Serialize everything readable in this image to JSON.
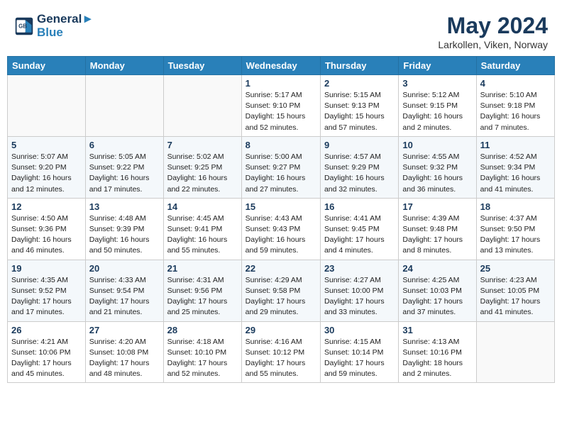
{
  "header": {
    "logo_line1": "General",
    "logo_line2": "Blue",
    "month": "May 2024",
    "location": "Larkollen, Viken, Norway"
  },
  "weekdays": [
    "Sunday",
    "Monday",
    "Tuesday",
    "Wednesday",
    "Thursday",
    "Friday",
    "Saturday"
  ],
  "weeks": [
    [
      {
        "day": "",
        "sunrise": "",
        "sunset": "",
        "daylight": ""
      },
      {
        "day": "",
        "sunrise": "",
        "sunset": "",
        "daylight": ""
      },
      {
        "day": "",
        "sunrise": "",
        "sunset": "",
        "daylight": ""
      },
      {
        "day": "1",
        "sunrise": "Sunrise: 5:17 AM",
        "sunset": "Sunset: 9:10 PM",
        "daylight": "Daylight: 15 hours and 52 minutes."
      },
      {
        "day": "2",
        "sunrise": "Sunrise: 5:15 AM",
        "sunset": "Sunset: 9:13 PM",
        "daylight": "Daylight: 15 hours and 57 minutes."
      },
      {
        "day": "3",
        "sunrise": "Sunrise: 5:12 AM",
        "sunset": "Sunset: 9:15 PM",
        "daylight": "Daylight: 16 hours and 2 minutes."
      },
      {
        "day": "4",
        "sunrise": "Sunrise: 5:10 AM",
        "sunset": "Sunset: 9:18 PM",
        "daylight": "Daylight: 16 hours and 7 minutes."
      }
    ],
    [
      {
        "day": "5",
        "sunrise": "Sunrise: 5:07 AM",
        "sunset": "Sunset: 9:20 PM",
        "daylight": "Daylight: 16 hours and 12 minutes."
      },
      {
        "day": "6",
        "sunrise": "Sunrise: 5:05 AM",
        "sunset": "Sunset: 9:22 PM",
        "daylight": "Daylight: 16 hours and 17 minutes."
      },
      {
        "day": "7",
        "sunrise": "Sunrise: 5:02 AM",
        "sunset": "Sunset: 9:25 PM",
        "daylight": "Daylight: 16 hours and 22 minutes."
      },
      {
        "day": "8",
        "sunrise": "Sunrise: 5:00 AM",
        "sunset": "Sunset: 9:27 PM",
        "daylight": "Daylight: 16 hours and 27 minutes."
      },
      {
        "day": "9",
        "sunrise": "Sunrise: 4:57 AM",
        "sunset": "Sunset: 9:29 PM",
        "daylight": "Daylight: 16 hours and 32 minutes."
      },
      {
        "day": "10",
        "sunrise": "Sunrise: 4:55 AM",
        "sunset": "Sunset: 9:32 PM",
        "daylight": "Daylight: 16 hours and 36 minutes."
      },
      {
        "day": "11",
        "sunrise": "Sunrise: 4:52 AM",
        "sunset": "Sunset: 9:34 PM",
        "daylight": "Daylight: 16 hours and 41 minutes."
      }
    ],
    [
      {
        "day": "12",
        "sunrise": "Sunrise: 4:50 AM",
        "sunset": "Sunset: 9:36 PM",
        "daylight": "Daylight: 16 hours and 46 minutes."
      },
      {
        "day": "13",
        "sunrise": "Sunrise: 4:48 AM",
        "sunset": "Sunset: 9:39 PM",
        "daylight": "Daylight: 16 hours and 50 minutes."
      },
      {
        "day": "14",
        "sunrise": "Sunrise: 4:45 AM",
        "sunset": "Sunset: 9:41 PM",
        "daylight": "Daylight: 16 hours and 55 minutes."
      },
      {
        "day": "15",
        "sunrise": "Sunrise: 4:43 AM",
        "sunset": "Sunset: 9:43 PM",
        "daylight": "Daylight: 16 hours and 59 minutes."
      },
      {
        "day": "16",
        "sunrise": "Sunrise: 4:41 AM",
        "sunset": "Sunset: 9:45 PM",
        "daylight": "Daylight: 17 hours and 4 minutes."
      },
      {
        "day": "17",
        "sunrise": "Sunrise: 4:39 AM",
        "sunset": "Sunset: 9:48 PM",
        "daylight": "Daylight: 17 hours and 8 minutes."
      },
      {
        "day": "18",
        "sunrise": "Sunrise: 4:37 AM",
        "sunset": "Sunset: 9:50 PM",
        "daylight": "Daylight: 17 hours and 13 minutes."
      }
    ],
    [
      {
        "day": "19",
        "sunrise": "Sunrise: 4:35 AM",
        "sunset": "Sunset: 9:52 PM",
        "daylight": "Daylight: 17 hours and 17 minutes."
      },
      {
        "day": "20",
        "sunrise": "Sunrise: 4:33 AM",
        "sunset": "Sunset: 9:54 PM",
        "daylight": "Daylight: 17 hours and 21 minutes."
      },
      {
        "day": "21",
        "sunrise": "Sunrise: 4:31 AM",
        "sunset": "Sunset: 9:56 PM",
        "daylight": "Daylight: 17 hours and 25 minutes."
      },
      {
        "day": "22",
        "sunrise": "Sunrise: 4:29 AM",
        "sunset": "Sunset: 9:58 PM",
        "daylight": "Daylight: 17 hours and 29 minutes."
      },
      {
        "day": "23",
        "sunrise": "Sunrise: 4:27 AM",
        "sunset": "Sunset: 10:00 PM",
        "daylight": "Daylight: 17 hours and 33 minutes."
      },
      {
        "day": "24",
        "sunrise": "Sunrise: 4:25 AM",
        "sunset": "Sunset: 10:03 PM",
        "daylight": "Daylight: 17 hours and 37 minutes."
      },
      {
        "day": "25",
        "sunrise": "Sunrise: 4:23 AM",
        "sunset": "Sunset: 10:05 PM",
        "daylight": "Daylight: 17 hours and 41 minutes."
      }
    ],
    [
      {
        "day": "26",
        "sunrise": "Sunrise: 4:21 AM",
        "sunset": "Sunset: 10:06 PM",
        "daylight": "Daylight: 17 hours and 45 minutes."
      },
      {
        "day": "27",
        "sunrise": "Sunrise: 4:20 AM",
        "sunset": "Sunset: 10:08 PM",
        "daylight": "Daylight: 17 hours and 48 minutes."
      },
      {
        "day": "28",
        "sunrise": "Sunrise: 4:18 AM",
        "sunset": "Sunset: 10:10 PM",
        "daylight": "Daylight: 17 hours and 52 minutes."
      },
      {
        "day": "29",
        "sunrise": "Sunrise: 4:16 AM",
        "sunset": "Sunset: 10:12 PM",
        "daylight": "Daylight: 17 hours and 55 minutes."
      },
      {
        "day": "30",
        "sunrise": "Sunrise: 4:15 AM",
        "sunset": "Sunset: 10:14 PM",
        "daylight": "Daylight: 17 hours and 59 minutes."
      },
      {
        "day": "31",
        "sunrise": "Sunrise: 4:13 AM",
        "sunset": "Sunset: 10:16 PM",
        "daylight": "Daylight: 18 hours and 2 minutes."
      },
      {
        "day": "",
        "sunrise": "",
        "sunset": "",
        "daylight": ""
      }
    ]
  ]
}
